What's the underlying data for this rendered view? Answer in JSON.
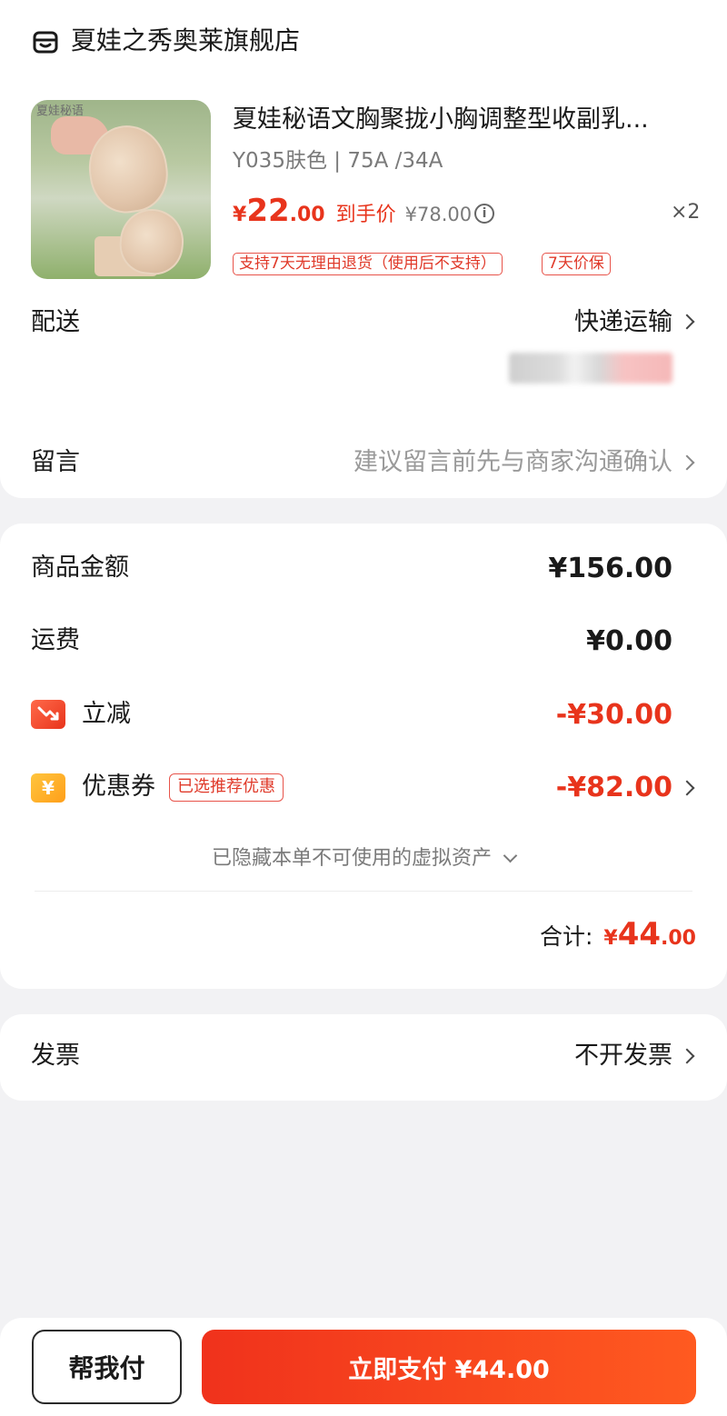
{
  "store": {
    "name": "夏娃之秀奥莱旗舰店",
    "icon": "store-icon"
  },
  "product": {
    "title": "夏娃秘语文胸聚拢小胸调整型收副乳...",
    "sku": "Y035肤色 | 75A /34A",
    "image_watermark": "夏娃秘语",
    "price_yen": "¥",
    "price_int": "22",
    "price_dec": ".00",
    "price_label": "到手价",
    "original_price": "¥78.00",
    "quantity": "×2",
    "tags": [
      "支持7天无理由退货（使用后不支持）",
      "7天价保"
    ]
  },
  "delivery": {
    "label": "配送",
    "value": "快递运输"
  },
  "message": {
    "label": "留言",
    "placeholder": "建议留言前先与商家沟通确认"
  },
  "summary": {
    "goods_label": "商品金额",
    "goods_amount": "¥156.00",
    "shipping_label": "运费",
    "shipping_amount": "¥0.00",
    "discount_label": "立减",
    "discount_amount": "-¥30.00",
    "coupon_label": "优惠券",
    "coupon_tag": "已选推荐优惠",
    "coupon_amount": "-¥82.00",
    "hidden_note": "已隐藏本单不可使用的虚拟资产",
    "total_label": "合计:",
    "total_yen": "¥",
    "total_int": "44",
    "total_dec": ".00"
  },
  "invoice": {
    "label": "发票",
    "value": "不开发票"
  },
  "actions": {
    "help_pay": "帮我付",
    "pay_now": "立即支付 ¥44.00"
  },
  "colors": {
    "accent_red": "#e8341c",
    "coupon_orange": "#ff9f1a",
    "background": "#f2f2f4"
  }
}
